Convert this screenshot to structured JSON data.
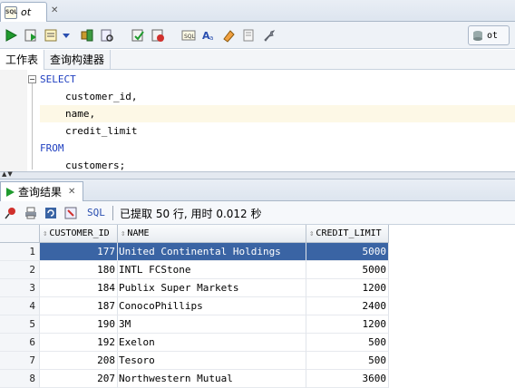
{
  "window": {
    "tab_label": "ot",
    "tab_icon_text": "SQL"
  },
  "connection": {
    "label": "ot"
  },
  "subtabs": [
    {
      "label": "工作表"
    },
    {
      "label": "查询构建器"
    }
  ],
  "editor": {
    "lines": [
      {
        "text": "SELECT",
        "keyword": true,
        "indent": 0
      },
      {
        "text": "customer_id,",
        "keyword": false,
        "indent": 1
      },
      {
        "text": "name,",
        "keyword": false,
        "indent": 1,
        "highlighted": true
      },
      {
        "text": "credit_limit",
        "keyword": false,
        "indent": 1
      },
      {
        "text": "FROM",
        "keyword": true,
        "indent": 0
      },
      {
        "text": "customers;",
        "keyword": false,
        "indent": 1
      }
    ]
  },
  "results": {
    "tab_label": "查询结果",
    "sql_label": "SQL",
    "status": "已提取 50 行, 用时 0.012 秒",
    "columns": [
      "CUSTOMER_ID",
      "NAME",
      "CREDIT_LIMIT"
    ],
    "rows": [
      {
        "num": "1",
        "id": "177",
        "name": "United Continental Holdings",
        "limit": "5000",
        "selected": true
      },
      {
        "num": "2",
        "id": "180",
        "name": "INTL FCStone",
        "limit": "5000"
      },
      {
        "num": "3",
        "id": "184",
        "name": "Publix Super Markets",
        "limit": "1200"
      },
      {
        "num": "4",
        "id": "187",
        "name": "ConocoPhillips",
        "limit": "2400"
      },
      {
        "num": "5",
        "id": "190",
        "name": "3M",
        "limit": "1200"
      },
      {
        "num": "6",
        "id": "192",
        "name": "Exelon",
        "limit": "500"
      },
      {
        "num": "7",
        "id": "208",
        "name": "Tesoro",
        "limit": "500"
      },
      {
        "num": "8",
        "id": "207",
        "name": "Northwestern Mutual",
        "limit": "3600"
      }
    ]
  },
  "colors": {
    "keyword": "#2040c0",
    "selection": "#3a64a4",
    "sql_link": "#2a4fb0"
  }
}
